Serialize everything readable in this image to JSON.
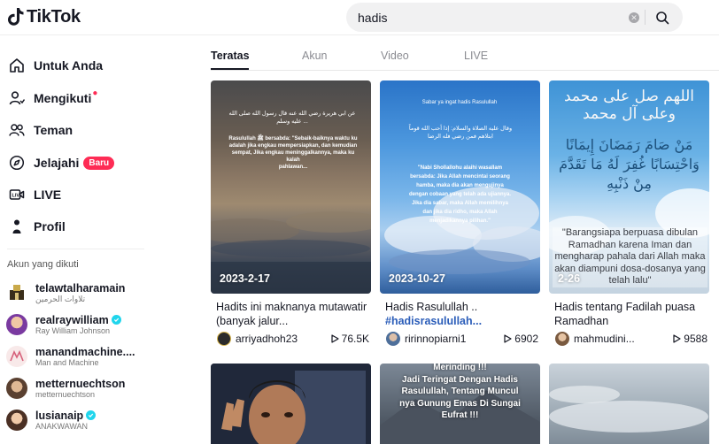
{
  "header": {
    "logo_text": "TikTok",
    "search": {
      "value": "hadis",
      "clear_glyph": "✕"
    }
  },
  "sidebar": {
    "nav": [
      {
        "label": "Untuk Anda",
        "icon": "home-icon"
      },
      {
        "label": "Mengikuti",
        "icon": "following-icon",
        "dot": "●"
      },
      {
        "label": "Teman",
        "icon": "friends-icon"
      },
      {
        "label": "Jelajahi",
        "icon": "explore-icon",
        "badge": "Baru"
      },
      {
        "label": "LIVE",
        "icon": "live-icon"
      },
      {
        "label": "Profil",
        "icon": "profile-icon"
      }
    ],
    "following_title": "Akun yang dikuti",
    "accounts": [
      {
        "name": "telawtalharamain",
        "sub": "تلاوات الحرمين",
        "verified": false,
        "avatar_color": "#c9b48a"
      },
      {
        "name": "realraywilliam",
        "sub": "Ray William Johnson",
        "verified": true,
        "avatar_color": "#b05fbf"
      },
      {
        "name": "manandmachine....",
        "sub": "Man and Machine",
        "verified": false,
        "avatar_color": "#f2dede"
      },
      {
        "name": "metternuechtson",
        "sub": "metternuechtson",
        "verified": false,
        "avatar_color": "#8a6a52"
      },
      {
        "name": "lusianaip",
        "sub": "ANAKWAWAN",
        "verified": true,
        "avatar_color": "#6b4b3a"
      }
    ]
  },
  "tabs": [
    "Teratas",
    "Akun",
    "Video",
    "LIVE"
  ],
  "cards": [
    {
      "date": "2023-2-17",
      "caption": "Hadits ini maknanya mutawatir (banyak jalur...",
      "caption_hashtag": "",
      "user": "arriyadhoh23",
      "views": "76.5K",
      "avatar_color": "#2b2b2b",
      "overlay_lines": [
        "Rasulullah ﷺ bersabda: \"Sebaik-baiknya waktu ku",
        "adalah jika engkau mempersiapkan, dan kemudian",
        "sempat, Jika engkau meninggalkannya, maka ku kalah",
        "pahlawan..."
      ]
    },
    {
      "date": "2023-10-27",
      "caption": "Hadis Rasulullah ..",
      "caption_hashtag": "#hadisrasulullah...",
      "user": "ririnnopiarni1",
      "views": "6902",
      "avatar_color": "#5f7ea6",
      "overlay_title": "Sabar ya ingat hadis Rasulullah",
      "overlay_lines": [
        "\"Nabi Shollallohu alaihi wasallam",
        "bersabda: Jika Allah mencintai seorang",
        "hamba, maka dia akan mengujinya",
        "dengan cobaan yang telah ada ujiannya.",
        "Jika dia sabar, maka Allah memilihnya",
        "dan jika dia ridho, maka Allah",
        "menjadikannya pilihan.\""
      ]
    },
    {
      "date": "2-26",
      "caption": "Hadis tentang Fadilah puasa Ramadhan",
      "caption_hashtag": "",
      "user": "mahmudini...",
      "views": "9588",
      "avatar_color": "#b38b6d",
      "arabic_top": "اللهم صل على محمد وعلى آل محمد",
      "arabic_mid_1": "مَنْ صَامَ رَمَضَانَ إِيمَانًا",
      "arabic_mid_2": "وَاحْتِسَابًا غُفِرَ لَهُ مَا تَقَدَّمَ",
      "arabic_mid_3": "مِنْ ذَنْبِهِ",
      "overlay_quote": "\"Barangsiapa berpuasa dibulan Ramadhan karena Iman dan mengharap pahala dari Allah maka akan diampuni dosa-dosanya yang telah lalu\""
    }
  ],
  "row2": [
    {
      "overlay_lines": []
    },
    {
      "overlay_lines": [
        "Merinding !!!",
        "Jadi Teringat Dengan Hadis",
        "Rasulullah, Tentang Muncul",
        "nya Gunung Emas Di Sungai",
        "Eufrat !!!"
      ]
    },
    {
      "overlay_lines": []
    }
  ],
  "colors": {
    "accent": "#fe2c55",
    "verified": "#20d5ec",
    "hashtag": "#2b5db9"
  }
}
